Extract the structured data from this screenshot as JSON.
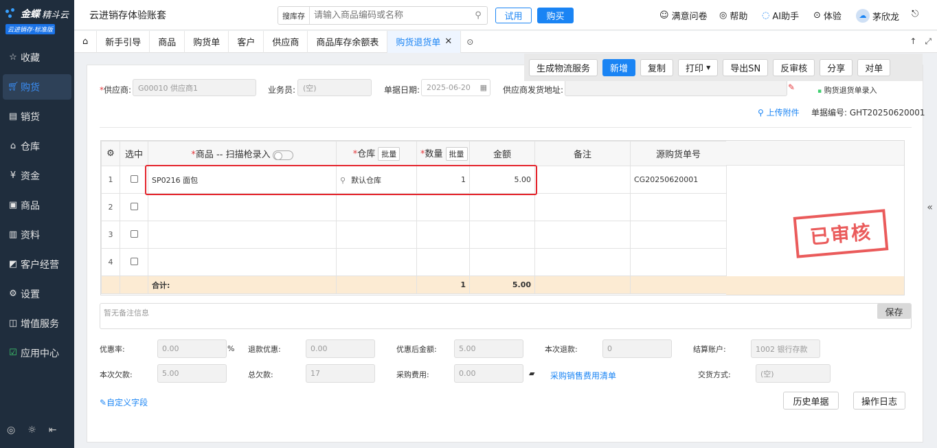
{
  "sidebar": {
    "brand": "金蝶",
    "brand_sub": "精斗云",
    "edition": "云进销存·标准版",
    "items": [
      {
        "label": "收藏",
        "icon": "star-icon"
      },
      {
        "label": "购货",
        "icon": "cart-icon",
        "active": true
      },
      {
        "label": "销货",
        "icon": "sales-doc-icon"
      },
      {
        "label": "仓库",
        "icon": "warehouse-icon"
      },
      {
        "label": "资金",
        "icon": "yen-icon"
      },
      {
        "label": "商品",
        "icon": "goods-icon"
      },
      {
        "label": "资料",
        "icon": "profile-icon"
      },
      {
        "label": "客户经营",
        "icon": "chart-icon"
      },
      {
        "label": "设置",
        "icon": "settings-icon"
      },
      {
        "label": "增值服务",
        "icon": "value-added-icon"
      },
      {
        "label": "应用中心",
        "icon": "app-center-icon"
      }
    ]
  },
  "topbar": {
    "title": "云进销存体验账套",
    "search_scope": "搜库存",
    "search_placeholder": "请输入商品编码或名称",
    "trial_label": "试用",
    "buy_label": "购买",
    "survey_label": "满意问卷",
    "help_label": "帮助",
    "ai_label": "AI助手",
    "experience_label": "体验",
    "user_name": "茅欣龙"
  },
  "tabs": [
    {
      "label": "新手引导"
    },
    {
      "label": "商品"
    },
    {
      "label": "购货单"
    },
    {
      "label": "客户"
    },
    {
      "label": "供应商"
    },
    {
      "label": "商品库存余额表"
    },
    {
      "label": "购货退货单",
      "active": true
    }
  ],
  "toolbar": {
    "logistics": "生成物流服务",
    "new": "新增",
    "copy": "复制",
    "print": "打印",
    "export_sn": "导出SN",
    "unaudit": "反审核",
    "share": "分享",
    "reconcile": "对单"
  },
  "form": {
    "supplier_label": "供应商:",
    "supplier_value": "G00010 供应商1",
    "salesman_label": "业务员:",
    "salesman_value": "(空)",
    "date_label": "单据日期:",
    "date_value": "2025-06-20",
    "address_label": "供应商发货地址:",
    "entry_label": "购货退货单录入",
    "upload_label": "上传附件",
    "doc_no_label": "单据编号:",
    "doc_no_value": "GHT20250620001"
  },
  "grid": {
    "headers": {
      "select": "选中",
      "product": "商品 -- 扫描枪录入",
      "warehouse": "仓库",
      "qty": "数量",
      "amount": "金额",
      "note": "备注",
      "source": "源购货单号",
      "batch": "批量"
    },
    "rows": [
      {
        "idx": "1",
        "product": "SP0216 面包",
        "warehouse": "默认仓库",
        "qty": "1",
        "amount": "5.00",
        "note": "",
        "source": "CG20250620001"
      },
      {
        "idx": "2",
        "product": "",
        "warehouse": "",
        "qty": "",
        "amount": "",
        "note": "",
        "source": ""
      },
      {
        "idx": "3",
        "product": "",
        "warehouse": "",
        "qty": "",
        "amount": "",
        "note": "",
        "source": ""
      },
      {
        "idx": "4",
        "product": "",
        "warehouse": "",
        "qty": "",
        "amount": "",
        "note": "",
        "source": ""
      }
    ],
    "total_label": "合计:",
    "total_qty": "1",
    "total_amount": "5.00"
  },
  "stamp": "已审核",
  "remark": {
    "placeholder": "暂无备注信息",
    "save_label": "保存"
  },
  "footer": {
    "discount_rate_label": "优惠率:",
    "discount_rate": "0.00",
    "percent": "%",
    "refund_discount_label": "退款优惠:",
    "refund_discount": "0.00",
    "after_discount_label": "优惠后金额:",
    "after_discount": "5.00",
    "this_refund_label": "本次退款:",
    "this_refund": "0",
    "account_label": "结算账户:",
    "account": "1002 银行存款",
    "this_debt_label": "本次欠款:",
    "this_debt": "5.00",
    "total_debt_label": "总欠款:",
    "total_debt": "17",
    "purchase_fee_label": "采购费用:",
    "purchase_fee": "0.00",
    "fee_list_link": "采购销售费用清单",
    "delivery_label": "交货方式:",
    "delivery": "(空)",
    "custom_fields": "自定义字段",
    "history_label": "历史单据",
    "log_label": "操作日志"
  }
}
